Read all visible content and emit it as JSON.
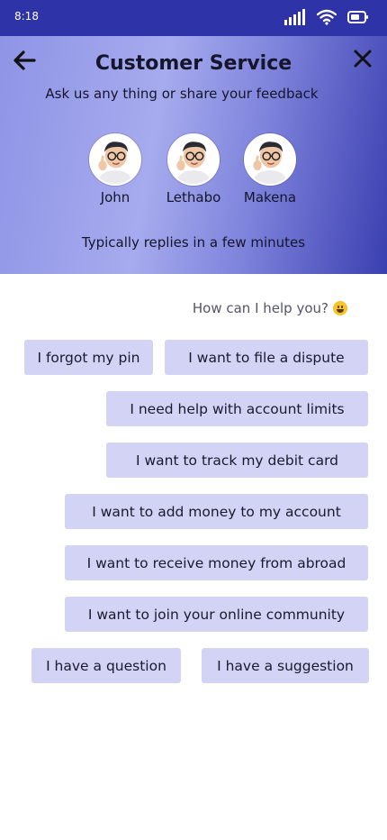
{
  "status_bar": {
    "time": "8:18"
  },
  "header": {
    "title": "Customer Service",
    "subtitle": "Ask us any thing or share your feedback",
    "agents": [
      {
        "name": "John"
      },
      {
        "name": "Lethabo"
      },
      {
        "name": "Makena"
      }
    ],
    "reply_note": "Typically replies in a few minutes"
  },
  "chat": {
    "prompt": "How can I help you?",
    "options": [
      "I forgot my pin",
      "I want to file a dispute",
      "I need help with account limits",
      "I want to track my debit card",
      "I want to add money to my account",
      "I want to receive money from abroad",
      "I want to join your online community",
      "I have a question",
      "I have a suggestion"
    ]
  },
  "colors": {
    "status_bar": "#2f33a8",
    "chip_background": "#d2d3f5",
    "header_gradient_start": "#8f94e6",
    "header_gradient_end": "#3a3fb0"
  }
}
